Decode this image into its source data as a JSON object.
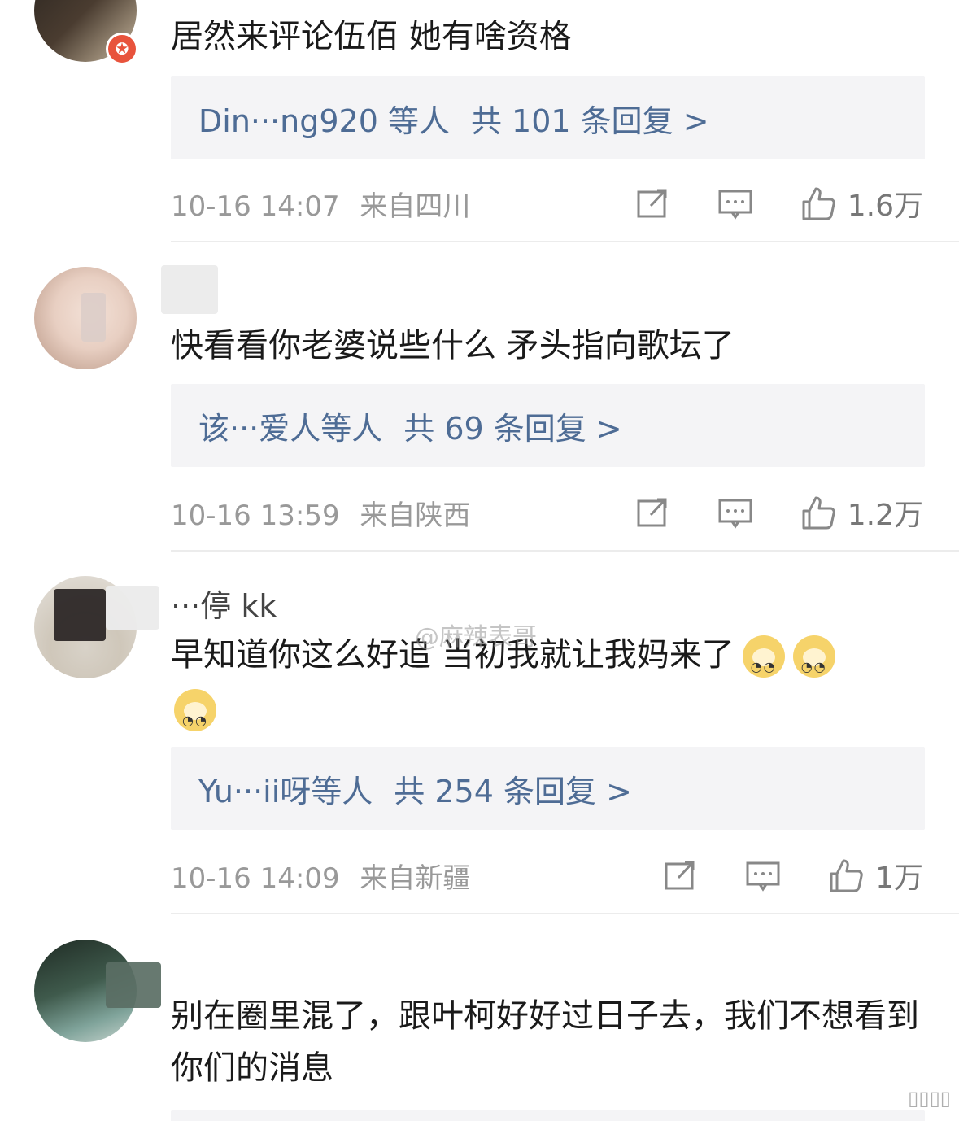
{
  "comments": [
    {
      "username": "",
      "text": "居然来评论伍佰 她有啥资格",
      "reply_users": "Din···ng920 等人",
      "reply_count": "共 101 条回复 >",
      "time": "10-16 14:07",
      "location": "来自四川",
      "likes": "1.6万"
    },
    {
      "username": "",
      "text": "快看看你老婆说些什么 矛头指向歌坛了",
      "reply_users": "该···爱人等人",
      "reply_count": "共 69 条回复 >",
      "time": "10-16 13:59",
      "location": "来自陕西",
      "likes": "1.2万"
    },
    {
      "username": "···停 kk",
      "text": "早知道你这么好追 当初我就让我妈来了",
      "reply_users": "Yu···ii呀等人",
      "reply_count": "共 254 条回复 >",
      "time": "10-16 14:09",
      "location": "来自新疆",
      "likes": "1万"
    },
    {
      "username": "",
      "text": "别在圈里混了，跟叶柯好好过日子去，我们不想看到你们的消息"
    }
  ],
  "watermark": "@麻辣表哥",
  "icons": {
    "repost": "repost-icon",
    "comment": "comment-icon",
    "like": "thumbs-up-icon",
    "emoji": "doge-emoji-icon"
  },
  "colors": {
    "link": "#4e6c95",
    "meta": "#999999",
    "reply_bg": "#f4f4f6",
    "badge": "#e8533c"
  }
}
